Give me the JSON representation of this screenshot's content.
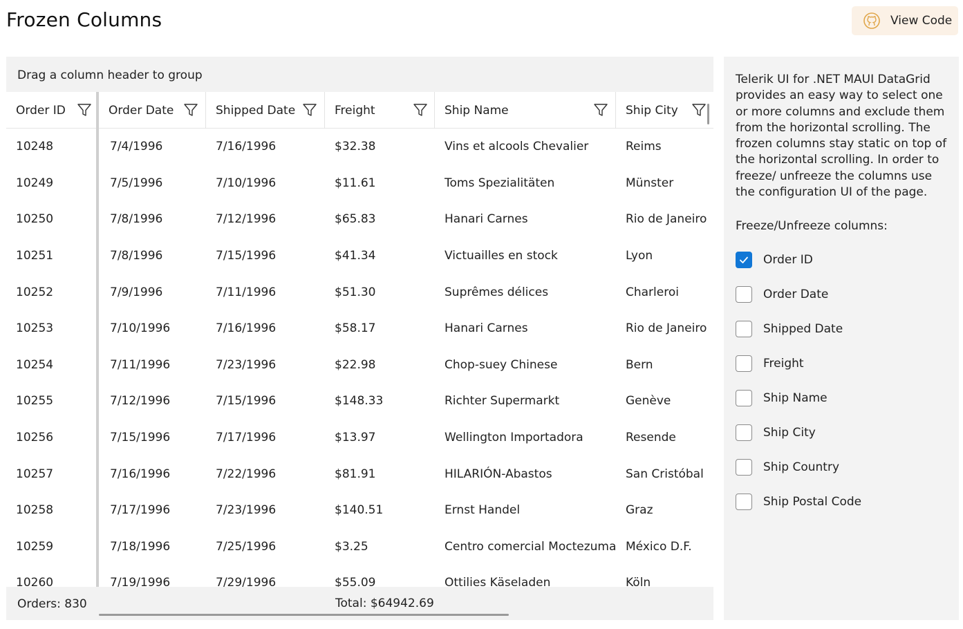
{
  "page": {
    "title": "Frozen Columns",
    "view_code_label": "View Code"
  },
  "grid": {
    "group_panel_text": "Drag a column header to group",
    "columns": [
      "Order ID",
      "Order Date",
      "Shipped Date",
      "Freight",
      "Ship Name",
      "Ship City"
    ],
    "rows": [
      [
        "10248",
        "7/4/1996",
        "7/16/1996",
        "$32.38",
        "Vins et alcools Chevalier",
        "Reims"
      ],
      [
        "10249",
        "7/5/1996",
        "7/10/1996",
        "$11.61",
        "Toms Spezialitäten",
        "Münster"
      ],
      [
        "10250",
        "7/8/1996",
        "7/12/1996",
        "$65.83",
        "Hanari Carnes",
        "Rio de Janeiro"
      ],
      [
        "10251",
        "7/8/1996",
        "7/15/1996",
        "$41.34",
        "Victuailles en stock",
        "Lyon"
      ],
      [
        "10252",
        "7/9/1996",
        "7/11/1996",
        "$51.30",
        "Suprêmes délices",
        "Charleroi"
      ],
      [
        "10253",
        "7/10/1996",
        "7/16/1996",
        "$58.17",
        "Hanari Carnes",
        "Rio de Janeiro"
      ],
      [
        "10254",
        "7/11/1996",
        "7/23/1996",
        "$22.98",
        "Chop-suey Chinese",
        "Bern"
      ],
      [
        "10255",
        "7/12/1996",
        "7/15/1996",
        "$148.33",
        "Richter Supermarkt",
        "Genève"
      ],
      [
        "10256",
        "7/15/1996",
        "7/17/1996",
        "$13.97",
        "Wellington Importadora",
        "Resende"
      ],
      [
        "10257",
        "7/16/1996",
        "7/22/1996",
        "$81.91",
        "HILARIÓN-Abastos",
        "San Cristóbal"
      ],
      [
        "10258",
        "7/17/1996",
        "7/23/1996",
        "$140.51",
        "Ernst Handel",
        "Graz"
      ],
      [
        "10259",
        "7/18/1996",
        "7/25/1996",
        "$3.25",
        "Centro comercial Moctezuma",
        "México D.F."
      ],
      [
        "10260",
        "7/19/1996",
        "7/29/1996",
        "$55.09",
        "Ottilies Käseladen",
        "Köln"
      ]
    ],
    "footer": {
      "orders": "Orders: 830",
      "total": "Total: $64942.69"
    }
  },
  "side_panel": {
    "description": "Telerik UI for .NET MAUI DataGrid provides an easy way to select one or more columns and exclude them from the horizontal scrolling. The frozen columns stay static on top of the horizontal scrolling. In order to freeze/ unfreeze the columns use the configuration UI of the page.",
    "freeze_label": "Freeze/Unfreeze columns:",
    "checkboxes": [
      {
        "label": "Order ID",
        "checked": true
      },
      {
        "label": "Order Date",
        "checked": false
      },
      {
        "label": "Shipped Date",
        "checked": false
      },
      {
        "label": "Freight",
        "checked": false
      },
      {
        "label": "Ship Name",
        "checked": false
      },
      {
        "label": "Ship City",
        "checked": false
      },
      {
        "label": "Ship Country",
        "checked": false
      },
      {
        "label": "Ship Postal Code",
        "checked": false
      }
    ]
  },
  "colors": {
    "accent": "#1177d6",
    "panel_bg": "#f3f3f3",
    "button_bg": "#fbf1e6"
  },
  "icons": {
    "view_code": "github-icon",
    "column_filter": "filter-icon",
    "checkbox_checked": "check-icon"
  }
}
